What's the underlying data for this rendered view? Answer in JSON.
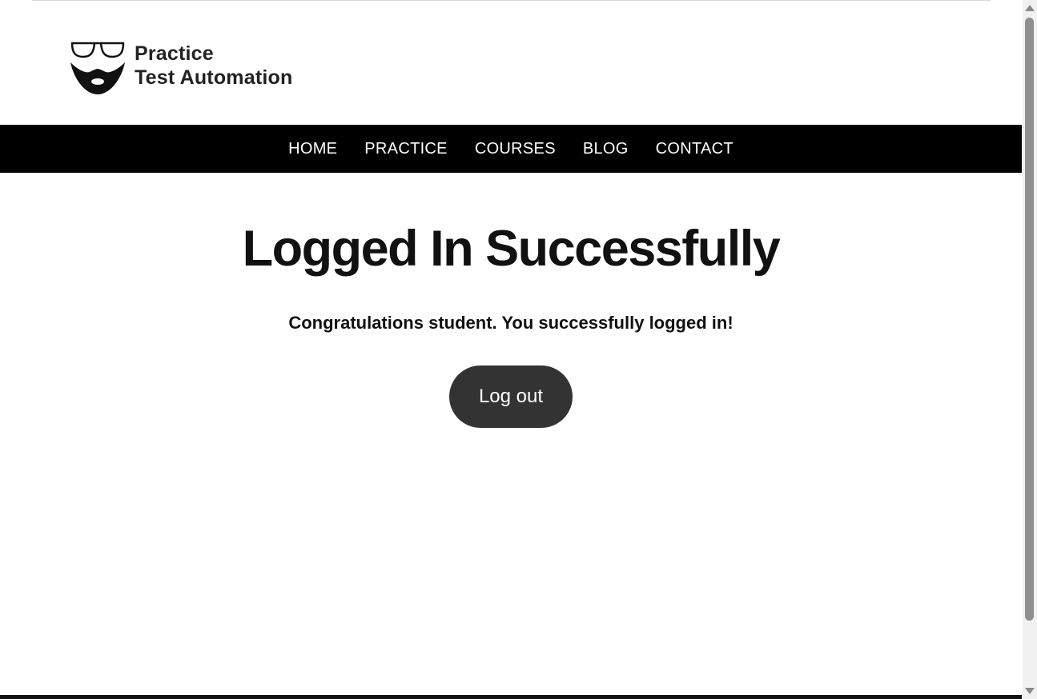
{
  "site": {
    "logo_line1": "Practice",
    "logo_line2": "Test Automation",
    "logo_icon": "glasses-beard-logo"
  },
  "nav": {
    "items": [
      {
        "label": "HOME"
      },
      {
        "label": "PRACTICE"
      },
      {
        "label": "COURSES"
      },
      {
        "label": "BLOG"
      },
      {
        "label": "CONTACT"
      }
    ]
  },
  "main": {
    "title": "Logged In Successfully",
    "message": "Congratulations student. You successfully logged in!",
    "logout_label": "Log out"
  },
  "colors": {
    "nav_bg": "#000000",
    "button_bg": "#333333",
    "text": "#111111"
  }
}
